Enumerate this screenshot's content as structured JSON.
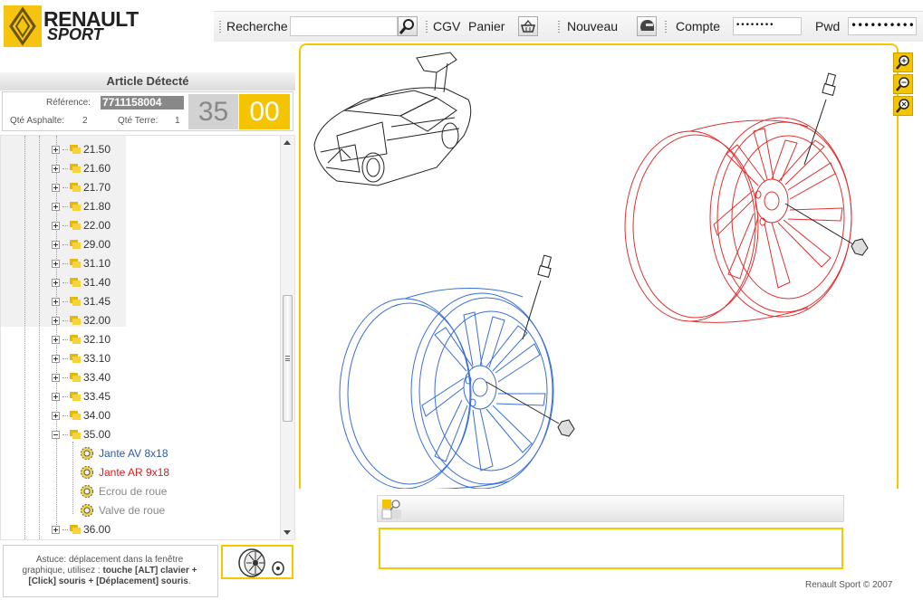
{
  "brand": {
    "word1": "RENAULT",
    "word2": "SPORT",
    "accent": "#f5c400"
  },
  "header": {
    "search_label": "Recherche",
    "search_value": "",
    "cgv_label": "CGV",
    "cart_label": "Panier",
    "new_label": "Nouveau",
    "account_label": "Compte",
    "account_value": "•••••••• ••••••",
    "password_label": "Pwd",
    "password_value": "••••••••••"
  },
  "article": {
    "title": "Article Détecté",
    "reference_label": "Référence:",
    "reference_value": "7711158004",
    "code_a": "35",
    "code_b": "00",
    "qty_asphalt_label": "Qté Asphalte:",
    "qty_asphalt_value": "2",
    "qty_terre_label": "Qté Terre:",
    "qty_terre_value": "1"
  },
  "tree": {
    "folders": [
      "21.50",
      "21.60",
      "21.70",
      "21.80",
      "22.00",
      "29.00",
      "31.10",
      "31.40",
      "31.45",
      "32.00",
      "32.10",
      "33.10",
      "33.40",
      "33.45",
      "34.00",
      "35.00"
    ],
    "leaves": [
      {
        "label": "Jante AV 8x18",
        "color": "#2a5aa8"
      },
      {
        "label": "Jante AR 9x18",
        "color": "#d42020"
      },
      {
        "label": "Ecrou de roue",
        "color": "#888888"
      },
      {
        "label": "Valve de roue",
        "color": "#888888"
      }
    ],
    "after": [
      "36.00"
    ]
  },
  "hint": {
    "line1": "Astuce: déplacement dans la fenêtre",
    "line2": "graphique, utilisez :",
    "bold1": "touche [ALT] clavier +",
    "bold2": "[Click] souris + [Déplacement] souris",
    "end": "."
  },
  "footer": {
    "copyright": "Renault Sport © 2007"
  }
}
